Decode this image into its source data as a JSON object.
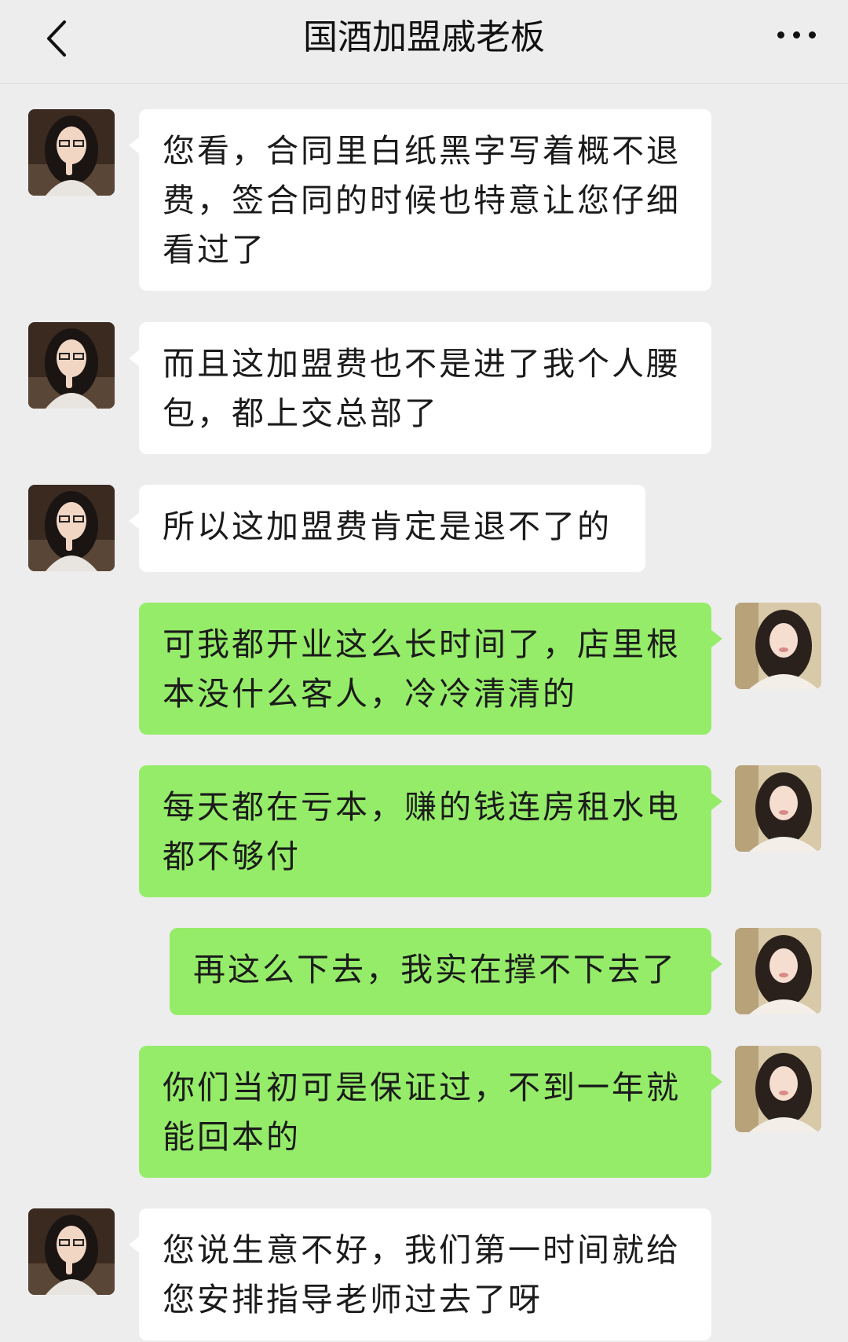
{
  "header": {
    "title": "国酒加盟戚老板",
    "back_icon": "chevron-left-icon",
    "more_icon": "more-dots-icon"
  },
  "colors": {
    "background": "#ededed",
    "incoming_bubble": "#ffffff",
    "outgoing_bubble": "#95ec69"
  },
  "messages": [
    {
      "side": "left",
      "text": "您看，合同里白纸黑字写着概不退费，签合同的时候也特意让您仔细看过了"
    },
    {
      "side": "left",
      "text": "而且这加盟费也不是进了我个人腰包，都上交总部了"
    },
    {
      "side": "left",
      "text": "所以这加盟费肯定是退不了的"
    },
    {
      "side": "right",
      "text": "可我都开业这么长时间了，店里根本没什么客人，冷冷清清的"
    },
    {
      "side": "right",
      "text": "每天都在亏本，赚的钱连房租水电都不够付"
    },
    {
      "side": "right",
      "text": "再这么下去，我实在撑不下去了"
    },
    {
      "side": "right",
      "text": "你们当初可是保证过，不到一年就能回本的"
    },
    {
      "side": "left",
      "text": "您说生意不好，我们第一时间就给您安排指导老师过去了呀"
    }
  ]
}
